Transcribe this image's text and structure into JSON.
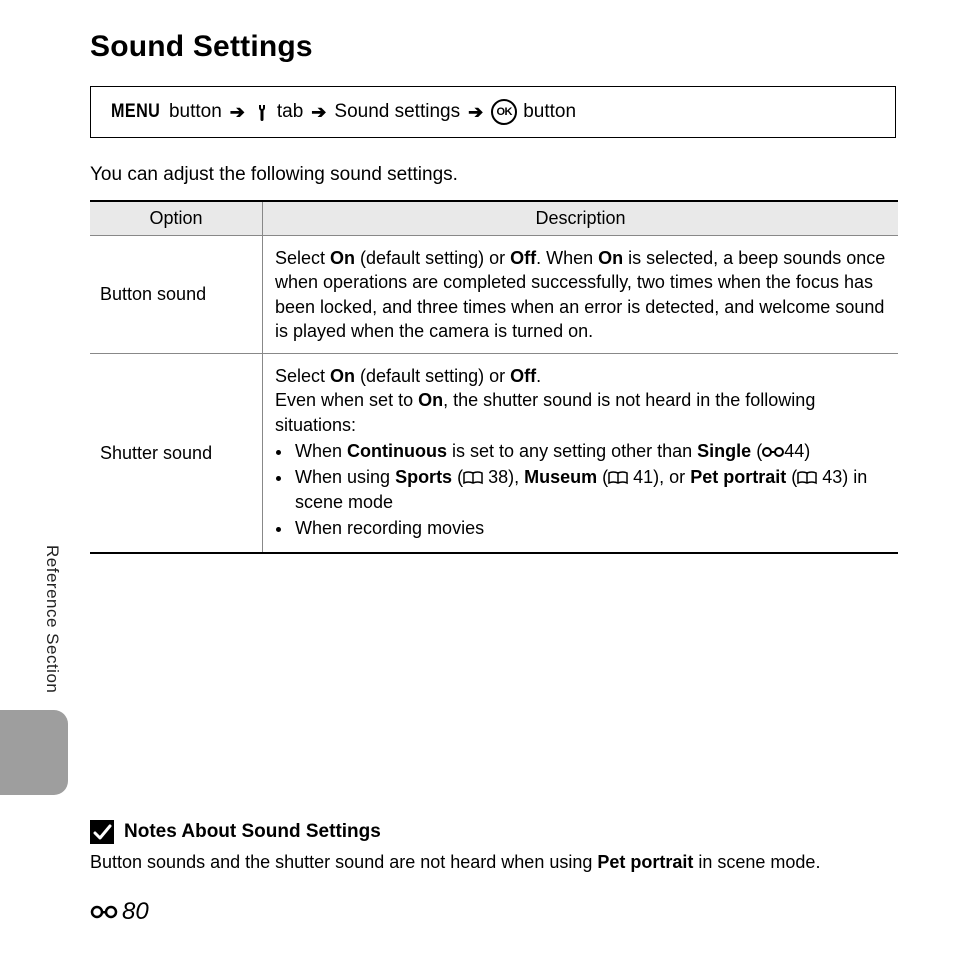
{
  "title": "Sound Settings",
  "breadcrumb": {
    "menu_label": "MENU",
    "button_word1": "button",
    "tab_word": "tab",
    "item_label": "Sound settings",
    "button_word2": "button",
    "ok_label": "OK"
  },
  "intro": "You can adjust the following sound settings.",
  "table": {
    "headers": {
      "option": "Option",
      "description": "Description"
    },
    "rows": [
      {
        "option": "Button sound",
        "desc_pre": "Select ",
        "on1": "On",
        "mid1": " (default setting) or ",
        "off1": "Off",
        "mid2": ". When ",
        "on2": "On",
        "rest": " is selected, a beep sounds once when operations are completed successfully, two times when the focus has been locked, and three times when an error is detected, and welcome sound is played when the camera is turned on."
      },
      {
        "option": "Shutter sound",
        "line1_pre": "Select ",
        "line1_on": "On",
        "line1_mid": " (default setting) or ",
        "line1_off": "Off",
        "line1_end": ".",
        "line2_pre": "Even when set to ",
        "line2_on": "On",
        "line2_rest": ", the shutter sound is not heard in the following situations:",
        "bullet1_pre": "When ",
        "bullet1_b1": "Continuous",
        "bullet1_mid": " is set to any setting other than ",
        "bullet1_b2": "Single",
        "bullet1_ref": "44)",
        "bullet2_pre": "When using ",
        "bullet2_b1": "Sports",
        "bullet2_ref1": " 38), ",
        "bullet2_b2": "Museum",
        "bullet2_ref2": " 41), or ",
        "bullet2_b3": "Pet portrait",
        "bullet2_ref3": " 43) in scene mode",
        "bullet3": "When recording movies"
      }
    ]
  },
  "side_label": "Reference Section",
  "notes": {
    "heading": "Notes About Sound Settings",
    "body_pre": "Button sounds and the shutter sound are not heard when using ",
    "body_bold": "Pet portrait",
    "body_post": " in scene mode."
  },
  "page_number": "80"
}
